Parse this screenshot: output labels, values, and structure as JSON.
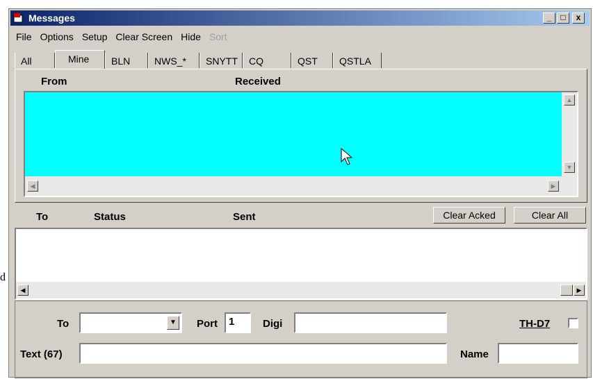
{
  "window": {
    "title": "Messages",
    "controls": {
      "minimize": "_",
      "maximize": "□",
      "close": "x"
    }
  },
  "menu": [
    {
      "label": "File",
      "enabled": true
    },
    {
      "label": "Options",
      "enabled": true
    },
    {
      "label": "Setup",
      "enabled": true
    },
    {
      "label": "Clear Screen",
      "enabled": true
    },
    {
      "label": "Hide",
      "enabled": true
    },
    {
      "label": "Sort",
      "enabled": false
    }
  ],
  "tabs": [
    "All",
    "Mine",
    "BLN",
    "NWS_*",
    "SNYTT",
    "CQ",
    "QST",
    "QSTLA"
  ],
  "active_tab": "Mine",
  "received": {
    "col_from": "From",
    "col_received": "Received",
    "fill_color": "#00ffff"
  },
  "sent": {
    "col_to": "To",
    "col_status": "Status",
    "col_sent": "Sent",
    "clear_acked": "Clear Acked",
    "clear_all": "Clear All"
  },
  "compose": {
    "to_label": "To",
    "to_value": "",
    "port_label": "Port",
    "port_value": "1",
    "digi_label": "Digi",
    "digi_value": "",
    "thd7_label": "TH-D7",
    "thd7_checked": false,
    "text_label": "Text (67)",
    "text_value": "",
    "name_label": "Name",
    "name_value": ""
  },
  "stray_char": "d"
}
